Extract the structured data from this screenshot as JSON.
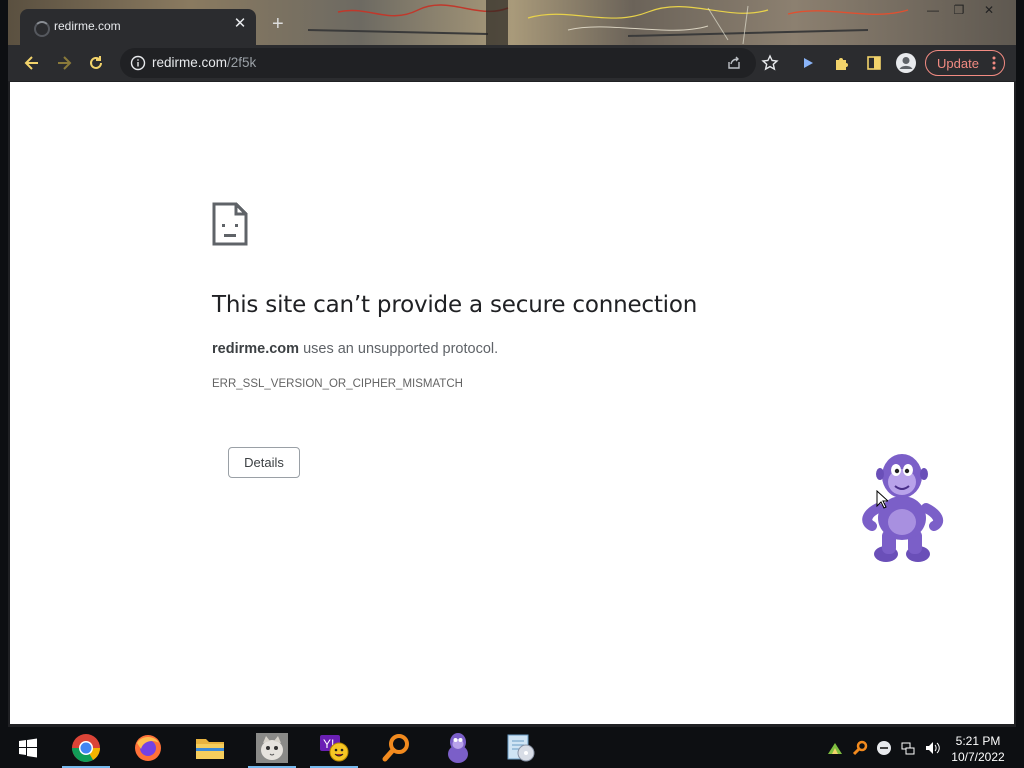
{
  "browser": {
    "tab_title": "redirme.com",
    "tab_close_glyph": "✕",
    "new_tab_glyph": "+",
    "url_host": "redirme.com",
    "url_path": "/2f5k",
    "update_label": "Update",
    "window_controls": {
      "minimize": "—",
      "maximize": "❐",
      "close": "✕"
    }
  },
  "error_page": {
    "title": "This site can’t provide a secure connection",
    "host": "redirme.com",
    "desc": " uses an unsupported protocol.",
    "code": "ERR_SSL_VERSION_OR_CIPHER_MISMATCH",
    "details_label": "Details"
  },
  "taskbar": {
    "time": "5:21 PM",
    "date": "10/7/2022",
    "apps": [
      "start-icon",
      "chrome-icon",
      "firefox-icon",
      "file-explorer-icon",
      "cat-photo-icon",
      "yahoo-messenger-icon",
      "search-app-icon",
      "bonzi-buddy-icon",
      "media-app-icon"
    ]
  },
  "colors": {
    "update": "#f28b82",
    "chrome_dark": "#2b2c2f",
    "bonzi_purple": "#7b5fc8"
  }
}
